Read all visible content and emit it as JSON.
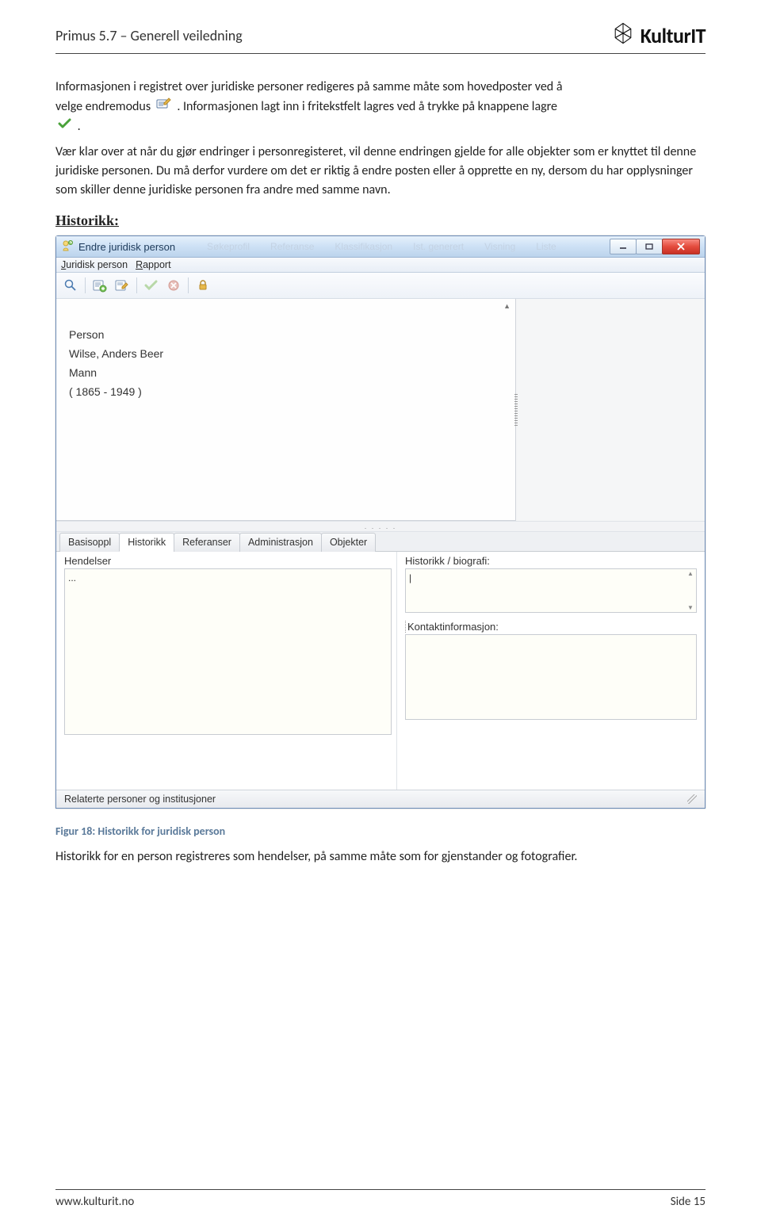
{
  "doc": {
    "header_title": "Primus 5.7 – Generell veiledning",
    "brand": "KulturIT",
    "footer_url": "www.kulturit.no",
    "footer_page": "Side 15"
  },
  "body": {
    "para1_a": "Informasjonen i registret over juridiske personer redigeres på samme måte som hovedposter ved å",
    "para1_b": "velge endremodus ",
    "para1_c": ". Informasjonen lagt inn i fritekstfelt lagres ved å trykke på knappene lagre",
    "para1_d": ".",
    "para2": "Vær klar over at når du gjør endringer i personregisteret, vil denne endringen gjelde for alle objekter som er knyttet til denne juridiske personen. Du må derfor vurdere om det er riktig å endre posten eller å opprette en ny, dersom du har opplysninger som skiller denne juridiske personen fra andre med samme navn.",
    "heading_historikk": "Historikk:",
    "caption": "Figur 18: Historikk for juridisk person",
    "para3": "Historikk for en person registreres som hendelser, på samme måte som for gjenstander og fotografier."
  },
  "app": {
    "title": "Endre juridisk person",
    "ghost_tabs": [
      "Søkeprofil",
      "Referanse",
      "Klassifikasjon",
      "Ist. generert",
      "Visning",
      "Liste"
    ],
    "menu": {
      "juridisk": "Juridisk person",
      "rapport_prefix": "R",
      "rapport_rest": "apport"
    },
    "person": {
      "type": "Person",
      "name": "Wilse, Anders Beer",
      "gender": "Mann",
      "dates": "( 1865 - 1949 )"
    },
    "tabs": [
      "Basisoppl",
      "Historikk",
      "Referanser",
      "Administrasjon",
      "Objekter"
    ],
    "active_tab_index": 1,
    "fields": {
      "hendelser_label": "Hendelser",
      "hendelser_value": "...",
      "historikk_label": "Historikk / biografi:",
      "kontakt_label": "Kontaktinformasjon:"
    },
    "statusbar": "Relaterte personer og institusjoner"
  }
}
